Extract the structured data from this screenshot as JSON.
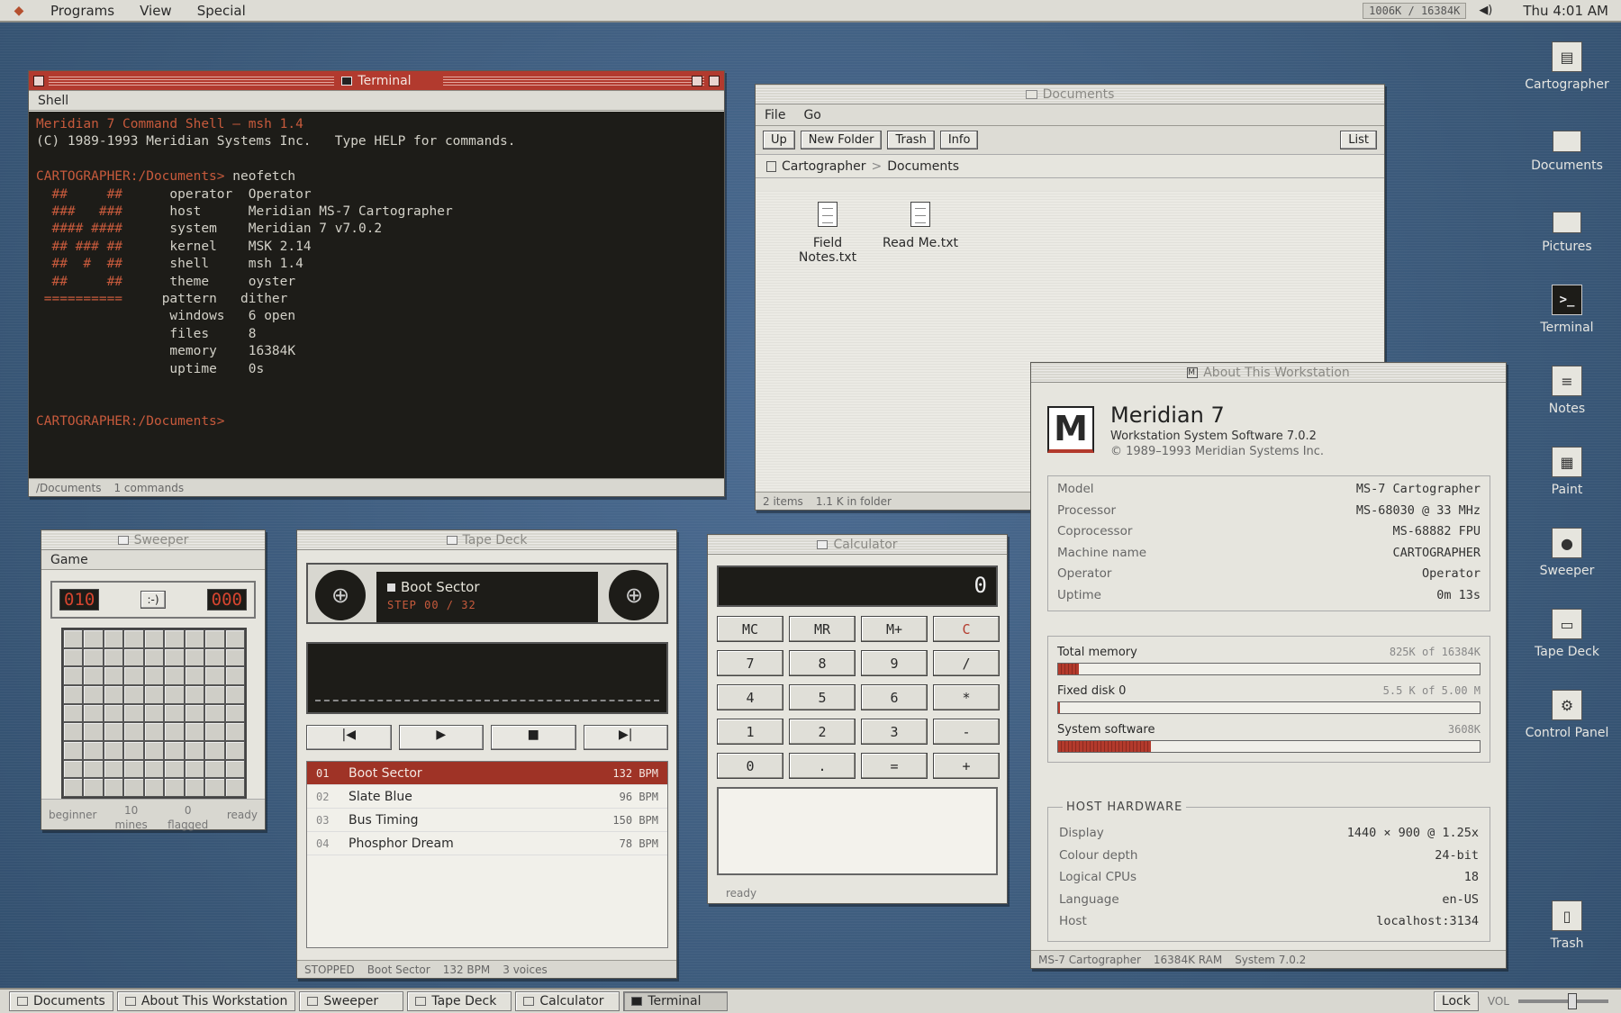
{
  "menubar": {
    "items": [
      "Programs",
      "View",
      "Special"
    ],
    "memory": "1006K / 16384K",
    "clock": "Thu 4:01 AM"
  },
  "terminal": {
    "title": "Terminal",
    "menu": "Shell",
    "lines": [
      {
        "c": "red",
        "t": "Meridian 7 Command Shell — msh 1.4"
      },
      {
        "c": "",
        "t": "(C) 1989-1993 Meridian Systems Inc.   Type HELP for commands."
      },
      {
        "c": "",
        "t": ""
      },
      {
        "c": "prompt",
        "t": "CARTOGRAPHER:/Documents> ",
        "cmd": "neofetch"
      },
      {
        "c": "nf",
        "a": "  ##     ##   ",
        "k": "operator",
        "v": "Operator"
      },
      {
        "c": "nf",
        "a": "  ###   ###   ",
        "k": "host    ",
        "v": "Meridian MS-7 Cartographer"
      },
      {
        "c": "nf",
        "a": "  #### ####   ",
        "k": "system  ",
        "v": "Meridian 7 v7.0.2"
      },
      {
        "c": "nf",
        "a": "  ## ### ##   ",
        "k": "kernel  ",
        "v": "MSK 2.14"
      },
      {
        "c": "nf",
        "a": "  ##  #  ##   ",
        "k": "shell   ",
        "v": "msh 1.4"
      },
      {
        "c": "nf",
        "a": "  ##     ##   ",
        "k": "theme   ",
        "v": "oyster"
      },
      {
        "c": "nf",
        "a": " ==========  ",
        "k": "pattern ",
        "v": "dither"
      },
      {
        "c": "nf",
        "a": "              ",
        "k": "windows ",
        "v": "6 open"
      },
      {
        "c": "nf",
        "a": "              ",
        "k": "files   ",
        "v": "8"
      },
      {
        "c": "nf",
        "a": "              ",
        "k": "memory  ",
        "v": "16384K"
      },
      {
        "c": "nf",
        "a": "              ",
        "k": "uptime  ",
        "v": "0s"
      },
      {
        "c": "",
        "t": ""
      },
      {
        "c": "",
        "t": ""
      },
      {
        "c": "prompt",
        "t": "CARTOGRAPHER:/Documents>",
        "cmd": ""
      }
    ],
    "status_path": "/Documents",
    "status_cmds": "1 commands"
  },
  "documents": {
    "title": "Documents",
    "menu": [
      "File",
      "Go"
    ],
    "buttons": [
      "Up",
      "New Folder",
      "Trash",
      "Info"
    ],
    "view_button": "List",
    "crumb_root": "Cartographer",
    "crumb_sep": ">",
    "crumb_cur": "Documents",
    "files": [
      "Field Notes.txt",
      "Read Me.txt"
    ],
    "status_items": "2 items",
    "status_size": "1.1 K in folder"
  },
  "about": {
    "title": "About This Workstation",
    "name": "Meridian 7",
    "subtitle": "Workstation System Software 7.0.2",
    "copyright": "© 1989–1993 Meridian Systems Inc.",
    "specs": [
      {
        "k": "Model",
        "v": "MS-7 Cartographer"
      },
      {
        "k": "Processor",
        "v": "MS-68030 @ 33 MHz"
      },
      {
        "k": "Coprocessor",
        "v": "MS-68882 FPU"
      },
      {
        "k": "Machine name",
        "v": "CARTOGRAPHER"
      },
      {
        "k": "Operator",
        "v": "Operator"
      },
      {
        "k": "Uptime",
        "v": "0m 13s"
      }
    ],
    "bars": [
      {
        "k": "Total memory",
        "v": "825K of 16384K",
        "pct": 0.05
      },
      {
        "k": "Fixed disk 0",
        "v": "5.5 K of 5.00 M",
        "pct": 0.001
      },
      {
        "k": "System software",
        "v": "3608K",
        "pct": 0.22
      }
    ],
    "hw_title": "HOST HARDWARE",
    "hw": [
      {
        "k": "Display",
        "v": "1440 × 900 @ 1.25x"
      },
      {
        "k": "Colour depth",
        "v": "24-bit"
      },
      {
        "k": "Logical CPUs",
        "v": "18"
      },
      {
        "k": "Language",
        "v": "en-US"
      },
      {
        "k": "Host",
        "v": "localhost:3134"
      }
    ],
    "status": [
      "MS-7 Cartographer",
      "16384K RAM",
      "System 7.0.2"
    ]
  },
  "sweeper": {
    "title": "Sweeper",
    "menu": "Game",
    "mines_display": "010",
    "face": ":-)",
    "timer": "000",
    "level": "beginner",
    "mines": "10 mines",
    "flagged": "0 flagged",
    "state": "ready"
  },
  "tape": {
    "title": "Tape Deck",
    "track": "Boot Sector",
    "step": "STEP 00 / 32",
    "tracks": [
      {
        "n": "01",
        "t": "Boot Sector",
        "b": "132 BPM"
      },
      {
        "n": "02",
        "t": "Slate Blue",
        "b": "96 BPM"
      },
      {
        "n": "03",
        "t": "Bus Timing",
        "b": "150 BPM"
      },
      {
        "n": "04",
        "t": "Phosphor Dream",
        "b": "78 BPM"
      }
    ],
    "status": [
      "STOPPED",
      "Boot Sector",
      "132 BPM",
      "3 voices"
    ]
  },
  "calculator": {
    "title": "Calculator",
    "display": "0",
    "keys": [
      "MC",
      "MR",
      "M+",
      "C",
      "7",
      "8",
      "9",
      "/",
      "4",
      "5",
      "6",
      "*",
      "1",
      "2",
      "3",
      "-",
      "0",
      ".",
      "=",
      "+"
    ],
    "status": "ready"
  },
  "desktop_icons": [
    "Cartographer",
    "Documents",
    "Pictures",
    "Terminal",
    "Notes",
    "Paint",
    "Sweeper",
    "Tape Deck",
    "Control Panel",
    "Trash"
  ],
  "taskbar": {
    "items": [
      "Documents",
      "About This Workstation",
      "Sweeper",
      "Tape Deck",
      "Calculator",
      "Terminal"
    ],
    "lock": "Lock",
    "vol": "VOL",
    "volume": 0.6
  },
  "colors": {
    "accent": "#b23a2e",
    "desktop": "#3f5f84"
  }
}
